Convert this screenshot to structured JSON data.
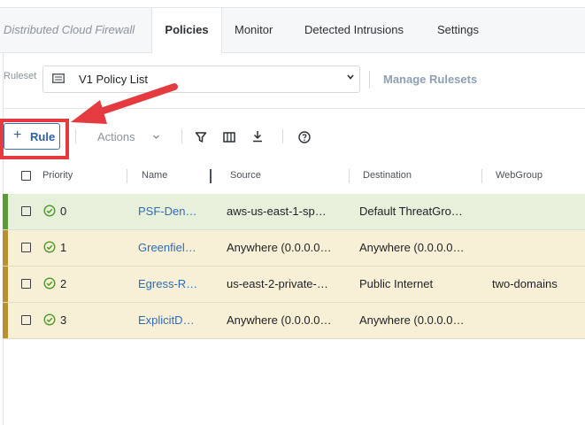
{
  "tabs": {
    "brand": "Distributed Cloud Firewall",
    "items": [
      "Policies",
      "Monitor",
      "Detected Intrusions",
      "Settings"
    ]
  },
  "ruleset": {
    "label": "Ruleset",
    "selected": "V1 Policy List",
    "manage_label": "Manage Rulesets"
  },
  "toolbar": {
    "add_rule_label": "Rule",
    "actions_label": "Actions"
  },
  "table": {
    "headers": [
      "Priority",
      "Name",
      "Source",
      "Destination",
      "WebGroup"
    ],
    "rows": [
      {
        "priority": "0",
        "name": "PSF-Den…",
        "source": "aws-us-east-1-sp…",
        "destination": "Default ThreatGro…",
        "webgroup": ""
      },
      {
        "priority": "1",
        "name": "Greenfiel…",
        "source": "Anywhere (0.0.0.0…",
        "destination": "Anywhere (0.0.0.0…",
        "webgroup": ""
      },
      {
        "priority": "2",
        "name": "Egress-R…",
        "source": "us-east-2-private-…",
        "destination": "Public Internet",
        "webgroup": "two-domains"
      },
      {
        "priority": "3",
        "name": "ExplicitD…",
        "source": "Anywhere (0.0.0.0…",
        "destination": "Anywhere (0.0.0.0…",
        "webgroup": ""
      }
    ]
  },
  "colors": {
    "row_0_bg": "#e6f0da",
    "row_0_stripe": "#5b9a3a",
    "row_bg": "#f8f0d6",
    "row_stripe": "#b8912e",
    "accent": "#2d5fa8",
    "highlight": "#e53a3f"
  },
  "icons": [
    "ruleset-list-icon",
    "chevron-down-icon",
    "plus-icon",
    "filter-icon",
    "columns-icon",
    "download-icon",
    "help-icon",
    "check-circle-icon",
    "annotation-arrow"
  ]
}
